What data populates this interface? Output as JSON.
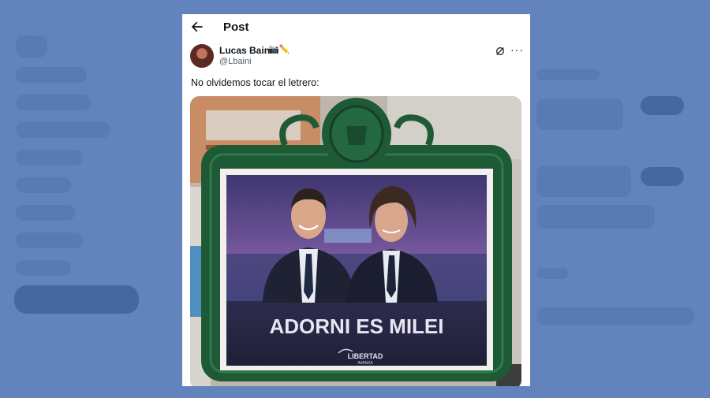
{
  "header": {
    "title": "Post",
    "back_icon": "arrow-left-icon"
  },
  "post": {
    "author_name": "Lucas Baini",
    "author_badges": "📷✏️",
    "author_handle": "@Lbaini",
    "text": "No olvidemos tocar el letrero:"
  },
  "image": {
    "poster_slogan": "ADORNI ES MILEI",
    "party_logo_main": "LIBERTAD",
    "party_logo_sub": "AVANZA"
  },
  "colors": {
    "backdrop": "#5f7fb6",
    "frame_green": "#1f5a36",
    "poster_dark": "#2b2a44"
  }
}
